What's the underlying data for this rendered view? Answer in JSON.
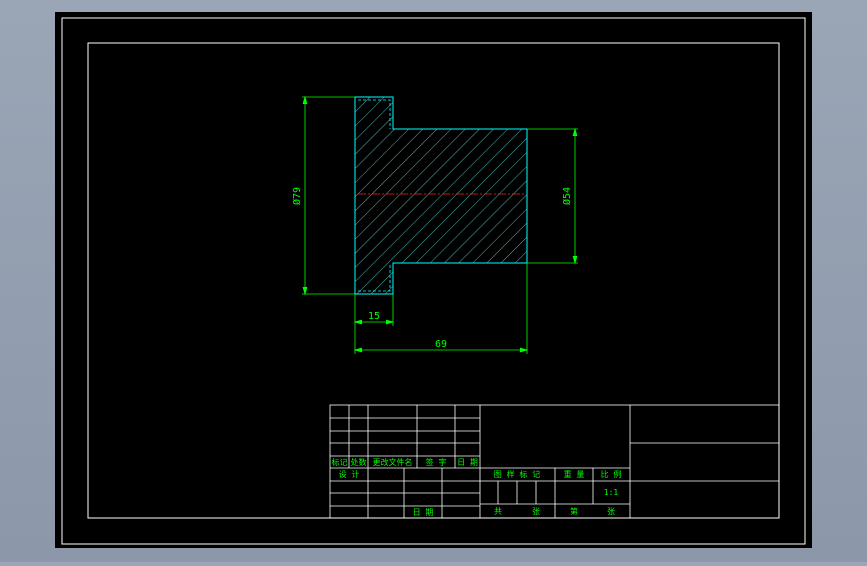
{
  "colors": {
    "background": "#000000",
    "frame": "#ffffff",
    "dimension": "#00ff00",
    "outline": "#00ffff",
    "hatch": "#4fb4b4",
    "centerline": "#ff2020",
    "title_text": "#00ff00"
  },
  "dimensions": {
    "outer_diameter": "Ø79",
    "shaft_diameter": "Ø54",
    "flange_width": "15",
    "total_length": "69"
  },
  "title_block": {
    "row_headers": [
      "标记",
      "处数",
      "更改文件名",
      "签 字",
      "日 期"
    ],
    "design_label": "设 计",
    "date_label": "日 期",
    "stage_labels": [
      "图 样 标 记"
    ],
    "weight_label": "重 量",
    "scale_label": "比 例",
    "scale_value": "1:1",
    "sheet_total_label": "共",
    "sheet_unit_1": "张",
    "sheet_index_label": "第",
    "sheet_unit_2": "张"
  }
}
